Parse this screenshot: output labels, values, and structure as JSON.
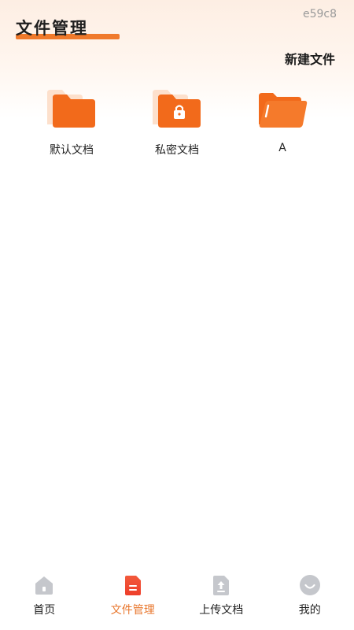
{
  "header": {
    "title": "文件管理",
    "code": "e59c8",
    "new_file_label": "新建文件"
  },
  "folders": [
    {
      "label": "默认文档",
      "icon": "folder-icon"
    },
    {
      "label": "私密文档",
      "icon": "lock-folder-icon"
    },
    {
      "label": "A",
      "icon": "open-folder-icon"
    }
  ],
  "bottom_nav": {
    "items": [
      {
        "label": "首页",
        "icon": "home-icon",
        "active": false
      },
      {
        "label": "文件管理",
        "icon": "document-icon",
        "active": true
      },
      {
        "label": "上传文档",
        "icon": "upload-icon",
        "active": false
      },
      {
        "label": "我的",
        "icon": "profile-icon",
        "active": false
      }
    ]
  },
  "colors": {
    "accent": "#f07a2c",
    "folder_orange": "#f26a1b",
    "folder_back": "#fde0cc",
    "nav_inactive": "#c5c7cc",
    "nav_active_label": "#e8762c"
  }
}
